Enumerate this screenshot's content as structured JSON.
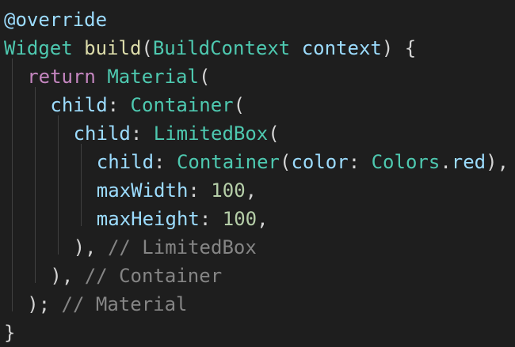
{
  "code": {
    "lines": [
      {
        "indent": 0,
        "tokens": [
          {
            "text": "@override",
            "kind": "param"
          }
        ]
      },
      {
        "indent": 0,
        "tokens": [
          {
            "text": "Widget",
            "kind": "type"
          },
          {
            "text": " ",
            "kind": "default"
          },
          {
            "text": "build",
            "kind": "func"
          },
          {
            "text": "(",
            "kind": "default"
          },
          {
            "text": "BuildContext",
            "kind": "type"
          },
          {
            "text": " ",
            "kind": "default"
          },
          {
            "text": "context",
            "kind": "param"
          },
          {
            "text": ") {",
            "kind": "default"
          }
        ]
      },
      {
        "indent": 1,
        "tokens": [
          {
            "text": "return",
            "kind": "keyword"
          },
          {
            "text": " ",
            "kind": "default"
          },
          {
            "text": "Material",
            "kind": "type"
          },
          {
            "text": "(",
            "kind": "default"
          }
        ]
      },
      {
        "indent": 2,
        "tokens": [
          {
            "text": "child",
            "kind": "param"
          },
          {
            "text": ": ",
            "kind": "default"
          },
          {
            "text": "Container",
            "kind": "type"
          },
          {
            "text": "(",
            "kind": "default"
          }
        ]
      },
      {
        "indent": 3,
        "tokens": [
          {
            "text": "child",
            "kind": "param"
          },
          {
            "text": ": ",
            "kind": "default"
          },
          {
            "text": "LimitedBox",
            "kind": "type"
          },
          {
            "text": "(",
            "kind": "default"
          }
        ]
      },
      {
        "indent": 4,
        "tokens": [
          {
            "text": "child",
            "kind": "param"
          },
          {
            "text": ": ",
            "kind": "default"
          },
          {
            "text": "Container",
            "kind": "type"
          },
          {
            "text": "(",
            "kind": "default"
          },
          {
            "text": "color",
            "kind": "param"
          },
          {
            "text": ": ",
            "kind": "default"
          },
          {
            "text": "Colors",
            "kind": "type"
          },
          {
            "text": ".",
            "kind": "default"
          },
          {
            "text": "red",
            "kind": "param"
          },
          {
            "text": "),",
            "kind": "default"
          }
        ]
      },
      {
        "indent": 4,
        "tokens": [
          {
            "text": "maxWidth",
            "kind": "param"
          },
          {
            "text": ": ",
            "kind": "default"
          },
          {
            "text": "100",
            "kind": "number"
          },
          {
            "text": ",",
            "kind": "default"
          }
        ]
      },
      {
        "indent": 4,
        "tokens": [
          {
            "text": "maxHeight",
            "kind": "param"
          },
          {
            "text": ": ",
            "kind": "default"
          },
          {
            "text": "100",
            "kind": "number"
          },
          {
            "text": ",",
            "kind": "default"
          }
        ]
      },
      {
        "indent": 3,
        "tokens": [
          {
            "text": "),",
            "kind": "default"
          },
          {
            "text": " ",
            "kind": "default"
          },
          {
            "text": "// LimitedBox",
            "kind": "comment-dim"
          }
        ]
      },
      {
        "indent": 2,
        "tokens": [
          {
            "text": "),",
            "kind": "default"
          },
          {
            "text": " ",
            "kind": "default"
          },
          {
            "text": "// Container",
            "kind": "comment-dim"
          }
        ]
      },
      {
        "indent": 1,
        "tokens": [
          {
            "text": ");",
            "kind": "default"
          },
          {
            "text": " ",
            "kind": "default"
          },
          {
            "text": "// Material",
            "kind": "comment-dim"
          }
        ]
      },
      {
        "indent": 0,
        "tokens": [
          {
            "text": "}",
            "kind": "default"
          }
        ]
      }
    ]
  },
  "colors": {
    "background": "#1e1e1e",
    "default": "#d4d4d4",
    "keyword": "#c586c0",
    "type": "#4ec9b0",
    "func": "#dcdcaa",
    "param": "#9cdcfe",
    "number": "#b5cea8",
    "comment": "#858585",
    "indent_guide": "#404040"
  }
}
